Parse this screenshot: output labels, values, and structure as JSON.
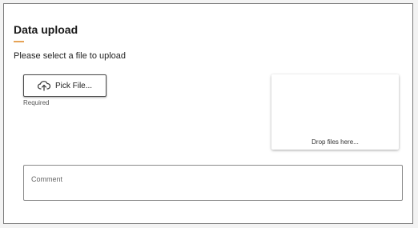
{
  "section": {
    "title": "Data upload",
    "instruction": "Please select a file to upload"
  },
  "upload": {
    "pick_button_label": "Pick File...",
    "pick_icon": "cloud-upload-icon",
    "required_note": "Required",
    "dropzone_text": "Drop files here..."
  },
  "comment": {
    "placeholder": "Comment"
  },
  "colors": {
    "accent_underline": "#e6a357",
    "border": "#7a7a7a"
  }
}
